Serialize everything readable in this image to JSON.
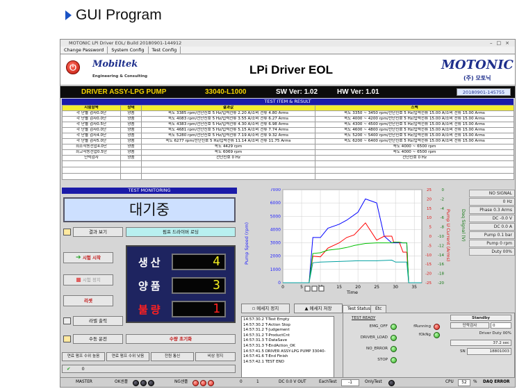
{
  "heading": "GUI Program",
  "window": {
    "title": "MOTONIC  LPi Driver EOL/ Build 20180901-144912",
    "menu": [
      "Change Password",
      "System Config",
      "Test Config"
    ]
  },
  "banner": {
    "mobiltek": "Mobiltek",
    "mobiltek_sub": "Engineering & Consulting",
    "title": "LPi Driver EOL",
    "motonic": "MOTONIC",
    "motonic_sub": "(주) 모토닉"
  },
  "info": {
    "product": "DRIVER ASSY-LPG PUMP",
    "part_no": "33040-L1000",
    "sw_ver": "SW Ver: 1.02",
    "hw_ver": "HW Ver: 1.01",
    "date": "20180901-145755"
  },
  "results": {
    "header": "TEST ITEM & RESULT",
    "columns": [
      "시험항목",
      "상태",
      "결과값",
      "스펙"
    ],
    "rows": [
      [
        "각 단별 검사0.0단",
        "양품",
        "속도 3385 rpm/전단신호 5 Hz/입력전류 2.20 A/소비 전류 4.80 Arms",
        "속도 3350 ~ 3450 rpm/전단신호 5 Hz/입력전류 15.00 A/소비 전류 15.00 Arms"
      ],
      [
        "각 단별 검사0.0단",
        "양품",
        "속도 4083 rpm/전단신호 5 Hz/입력전류 3.55 A/소비 전류 6.27 Arms",
        "속도 4000 ~ 4200 rpm/전단신호 5 Hz/입력전류 15.00 A/소비 전류 15.00 Arms"
      ],
      [
        "각 단별 검사0.5단",
        "양품",
        "속도 4383 rpm/전단신호 5 Hz/입력전류 4.30 A/소비 전류 6.98 Arms",
        "속도 4300 ~ 4500 rpm/전단신호 5 Hz/입력전류 15.00 A/소비 전류 15.00 Arms"
      ],
      [
        "각 단별 검사0.0단",
        "양품",
        "속도 4681 rpm/전단신호 5 Hz/입력전류 5.15 A/소비 전류 7.74 Arms",
        "속도 4600 ~ 4800 rpm/전단신호 5 Hz/입력전류 15.00 A/소비 전류 15.00 Arms"
      ],
      [
        "각 단별 검사4.0단",
        "양품",
        "속도 5280 rpm/전단신호 5 Hz/입력전류 7.19 A/소비 전류 9.32 Arms",
        "속도 5200 ~ 5400 rpm/전단신호 5 Hz/입력전류 15.00 A/소비 전류 15.00 Arms"
      ],
      [
        "각 단별 검사5.0단",
        "양품",
        "속도 6277 rpm/전단신호 5 Hz/입력전류 11.14 A/소비 전류 11.75 Arms",
        "속도 6200 ~ 6400 rpm/전단신호 5 Hz/입력전류 15.00 A/소비 전류 15.00 Arms"
      ],
      [
        "최소작동전압4.0단",
        "양품",
        "속도 4429 rpm",
        "속도 4000 ~ 6500 rpm"
      ],
      [
        "최고작동전압0.5단",
        "양품",
        "속도 6069 rpm",
        "속도 4000 ~ 6500 rpm"
      ],
      [
        "단락검사",
        "양품",
        "전단신호 0 Hz",
        "전단신호 0 Hz"
      ]
    ]
  },
  "monitor": {
    "header": "TEST MONITORING",
    "status": "대기중",
    "result_view_btn": "결과 보기",
    "pump_driver_btn": "펌프 드라이버 로딩",
    "start_btn": "시험 시작",
    "stop_btn": "시험 정지",
    "reset_btn": "리셋",
    "label_print_btn": "라벨 출력",
    "manual_btn": "수동 운전",
    "count_reset_btn": "수량 초기화",
    "counters": [
      {
        "label": "생산",
        "value": "4"
      },
      {
        "label": "양품",
        "value": "3"
      },
      {
        "label": "불량",
        "value": "1"
      }
    ],
    "bottom_btns": [
      "연료 펌프 수위 높음",
      "연료 펌프 수위 낮음",
      "전원 통신",
      "비상 정지"
    ],
    "bottom_input_value": "0"
  },
  "right_values": [
    "NO SIGNAL",
    "0 Hz",
    "Phase 0.3 Arms",
    "DC -0.0 V",
    "DC 0.0 A",
    "Pump 0.1 bar",
    "Pump 0 rpm",
    "Duty 00%"
  ],
  "log": {
    "clear_btn": "메세지 정지",
    "save_btn": "메세지 저장",
    "lines": [
      "14:57:30.2 T-Test Empty",
      "14:57:30.2 T-Action Stop",
      "14:57:31.2 T-Judgement",
      "14:57:31.2 T-ProductCnt",
      "14:57:31.3 T-DataSave",
      "14:57:31.3 T-EndAction_OK",
      "14:57:41.5 DRIVER ASSY-LPG PUMP 33040-",
      "14:57:41.6 T-End Finish",
      "14:57:42.1 TEST END"
    ]
  },
  "status_tab": {
    "tabs": [
      "Test Status",
      "Etc"
    ],
    "ready_label": "TEST READY",
    "leds": [
      "EMG_OFF",
      "DRIVER_LOAD",
      "NO_ERROR",
      "STOP"
    ],
    "frunning": "fRunning",
    "fokng": "fOkNg",
    "standby": "Standby",
    "mode": "단락검사",
    "mode_value": "0",
    "duty": "Driver Duty 00%",
    "time": "37.2 sec",
    "sn_label": "SN",
    "sn": "18801003"
  },
  "statusbar": {
    "master": "MASTER",
    "ok_label": "OK센플",
    "ng_label": "NG센플",
    "v0": "0",
    "v1": "1",
    "dc_out": "DC 0.0 V OUT",
    "eachtest": "EachTest",
    "each_value": "-1",
    "onlytest": "OnlyTest",
    "cpu_label": "CPU",
    "cpu_value": "52",
    "cpu_unit": "%",
    "daq": "DAQ ERROR"
  },
  "chart_data": {
    "type": "line",
    "xlabel": "Time",
    "ylabel_left": "Pump Speed (rpm)",
    "ylabel_right1": "Pump U Current (Arms)",
    "ylabel_right2": "Daq Signal (V)",
    "xlim": [
      0,
      37
    ],
    "ylim_left": [
      0,
      7000
    ],
    "ylim_right1": [
      -25,
      25
    ],
    "ylim_right2": [
      -20,
      0
    ],
    "xticks": [
      0,
      5,
      10,
      15,
      20,
      25,
      30,
      35
    ],
    "yticks_left": [
      0,
      1000,
      2000,
      3000,
      4000,
      5000,
      6000,
      7000
    ],
    "yticks_right1": [
      -25,
      -20,
      -15,
      -10,
      -5,
      0,
      5,
      10,
      15,
      20,
      25
    ],
    "yticks_right2": [
      -20,
      -18,
      -16,
      -14,
      -12,
      -10,
      -8,
      -6,
      -4,
      -2,
      0
    ],
    "series": [
      {
        "color": "#0000ff",
        "x": [
          0,
          7,
          8,
          10,
          12,
          15,
          17,
          20,
          22,
          25,
          27,
          29,
          29.5,
          31,
          32,
          33,
          33.5,
          37
        ],
        "y": [
          0,
          0,
          3400,
          3400,
          4100,
          4400,
          4700,
          5300,
          6300,
          6000,
          3500,
          3000,
          3000,
          3000,
          3000,
          3000,
          0,
          0
        ]
      },
      {
        "color": "#ff0000",
        "x": [
          0,
          7,
          8,
          10,
          12,
          15,
          17,
          19,
          22,
          25,
          27,
          29,
          29.5,
          31,
          32,
          33,
          33.5,
          37
        ],
        "y": [
          0,
          0,
          2000,
          1950,
          2600,
          3000,
          3400,
          3600,
          4500,
          3200,
          3500,
          3500,
          3050,
          3050,
          2300,
          2300,
          0,
          0
        ]
      },
      {
        "color": "#00c000",
        "x": [
          0,
          7,
          8,
          10,
          12,
          15,
          17,
          19,
          22,
          25,
          27,
          29,
          29.5,
          31,
          32,
          33,
          33.5,
          37
        ],
        "y": [
          0,
          0,
          2200,
          2250,
          2450,
          2550,
          2650,
          2800,
          2950,
          3000,
          3000,
          3000,
          3050,
          3050,
          3000,
          3000,
          0,
          0
        ]
      },
      {
        "color": "#00a0a0",
        "x": [
          0,
          7,
          8,
          10,
          15,
          20,
          25,
          29,
          30,
          33,
          33.5,
          37
        ],
        "y": [
          0,
          0,
          1500,
          1550,
          1600,
          1650,
          1650,
          1700,
          1550,
          1550,
          0,
          0
        ]
      }
    ]
  }
}
